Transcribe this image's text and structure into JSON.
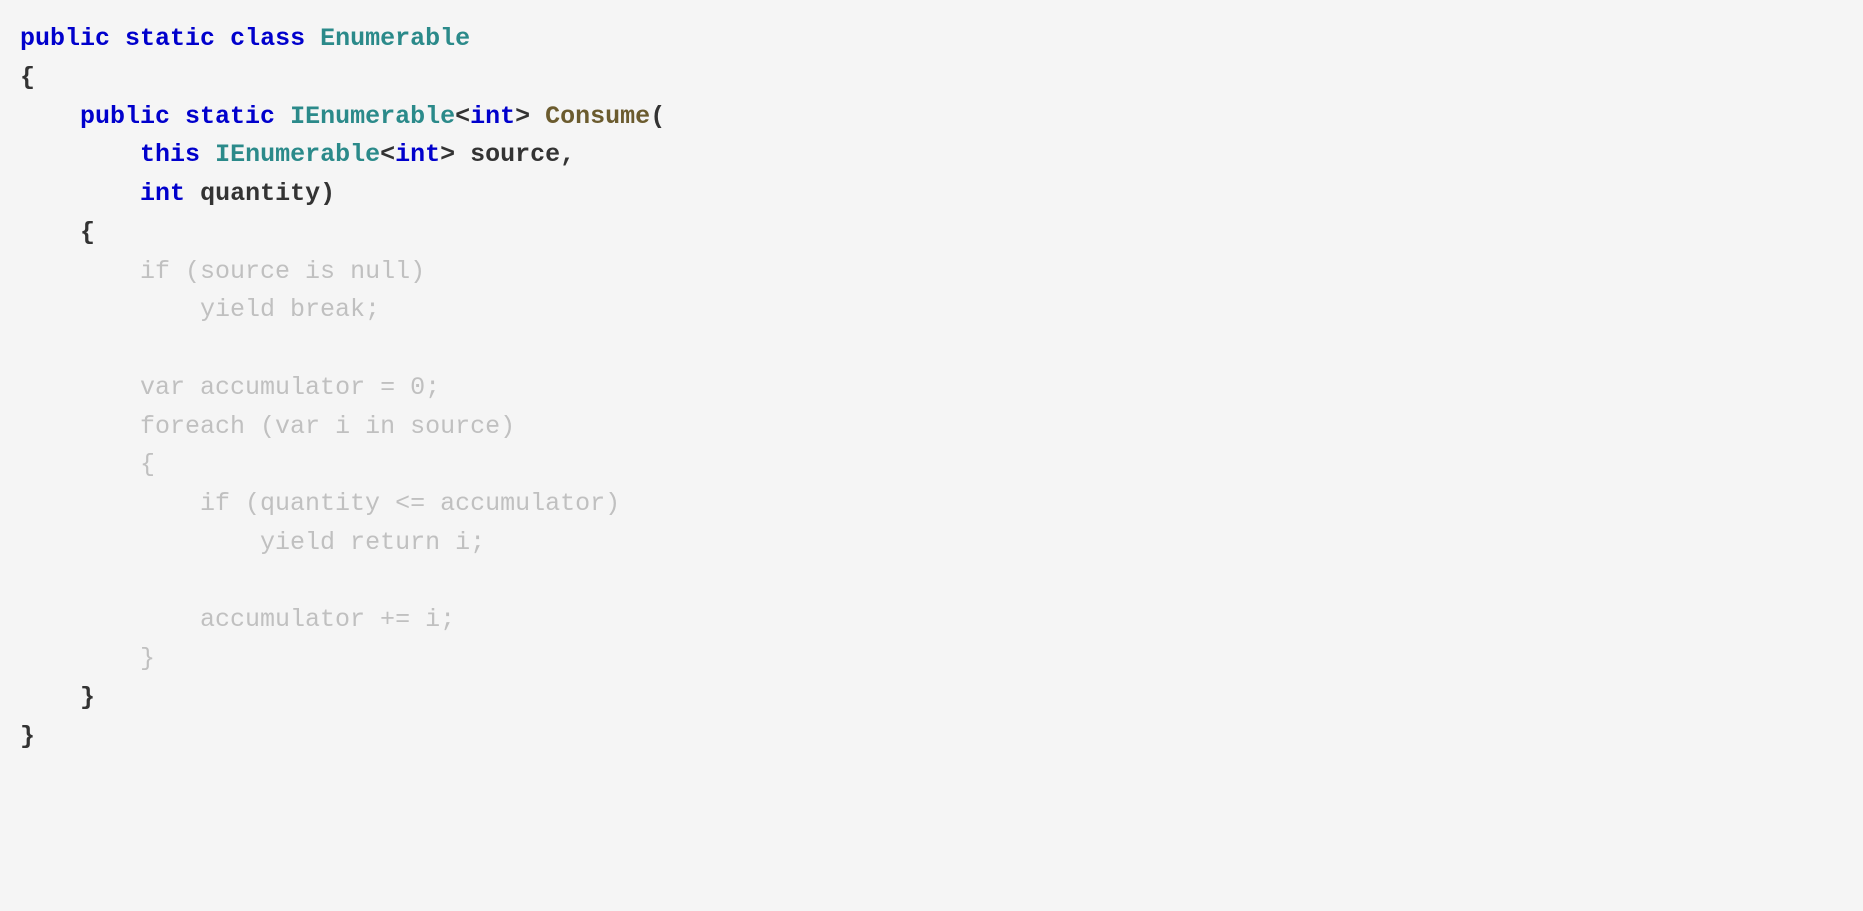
{
  "code": {
    "line1": {
      "kw_public": "public",
      "kw_static": "static",
      "kw_class": "class",
      "type_enumerable": "Enumerable"
    },
    "line2": {
      "brace": "{"
    },
    "line3": {
      "kw_public": "public",
      "kw_static": "static",
      "type_ienumerable": "IEnumerable",
      "lt": "<",
      "kw_int": "int",
      "gt": ">",
      "method": "Consume",
      "paren": "("
    },
    "line4": {
      "kw_this": "this",
      "type_ienumerable": "IEnumerable",
      "lt": "<",
      "kw_int": "int",
      "gt": ">",
      "param": "source",
      "comma": ","
    },
    "line5": {
      "kw_int": "int",
      "param": "quantity",
      "paren": ")"
    },
    "line6": {
      "brace": "{"
    },
    "line7": {
      "text": "if (source is null)"
    },
    "line8": {
      "text": "yield break;"
    },
    "line9": {
      "text": "var accumulator = 0;"
    },
    "line10": {
      "text": "foreach (var i in source)"
    },
    "line11": {
      "text": "{"
    },
    "line12": {
      "text": "if (quantity <= accumulator)"
    },
    "line13": {
      "text": "yield return i;"
    },
    "line14": {
      "text": "accumulator += i;"
    },
    "line15": {
      "text": "}"
    },
    "line16": {
      "brace": "}"
    },
    "line17": {
      "brace": "}"
    }
  }
}
